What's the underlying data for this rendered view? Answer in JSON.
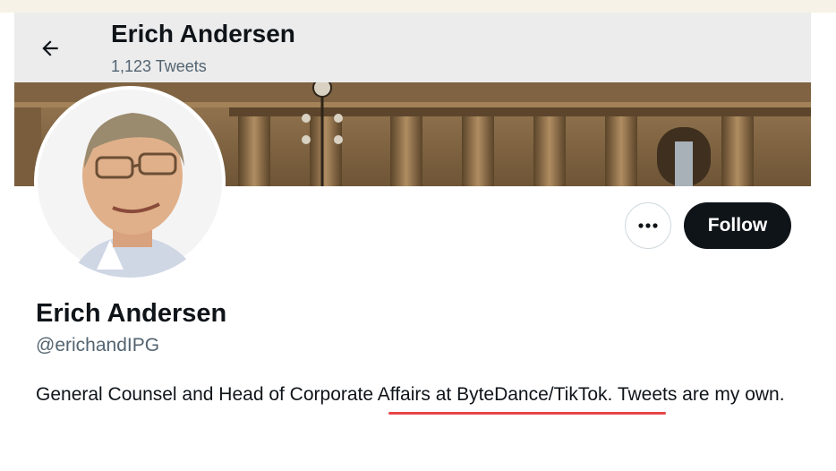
{
  "header": {
    "back_icon": "arrow-left-icon",
    "title": "Erich Andersen",
    "tweet_count": "1,123 Tweets"
  },
  "profile": {
    "name": "Erich Andersen",
    "handle": "@erichandIPG",
    "bio_part1": "General Counsel and Head of Corporate ",
    "bio_highlight": "Affairs at ByteDance/TikTok",
    "bio_part2": ". Tweets are my own."
  },
  "actions": {
    "more_icon": "more-horizontal-icon",
    "follow_label": "Follow"
  },
  "colors": {
    "text_primary": "#0f1419",
    "text_secondary": "#536471",
    "follow_bg": "#0f1419",
    "highlight_underline": "#e8454a"
  }
}
